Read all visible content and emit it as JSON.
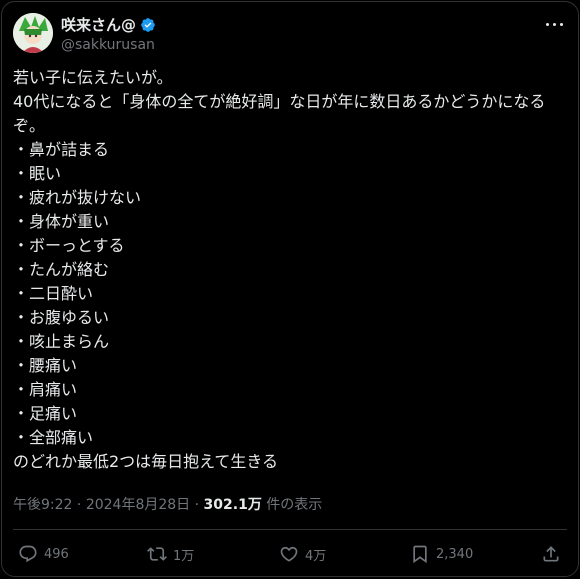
{
  "user": {
    "display_name": "咲来さん@",
    "handle": "@sakkurusan",
    "verified": true
  },
  "tweet": {
    "intro_1": "若い子に伝えたいが。",
    "intro_2": "40代になると「身体の全てが絶好調」な日が年に数日あるかどうかになるぞ。",
    "items": [
      "鼻が詰まる",
      "眠い",
      "疲れが抜けない",
      "身体が重い",
      "ボーっとする",
      "たんが絡む",
      "二日酔い",
      "お腹ゆるい",
      "咳止まらん",
      "腰痛い",
      "肩痛い",
      "足痛い",
      "全部痛い"
    ],
    "outro": "のどれか最低2つは毎日抱えて生きる"
  },
  "meta": {
    "time": "午後9:22",
    "date": "2024年8月28日",
    "views_count": "302.1万",
    "views_label": "件の表示"
  },
  "actions": {
    "replies": "496",
    "retweets": "1万",
    "likes": "4万",
    "bookmarks": "2,340"
  },
  "colors": {
    "background": "#000000",
    "text": "#e7e9ea",
    "muted": "#71767b",
    "verified": "#1d9bf0"
  }
}
